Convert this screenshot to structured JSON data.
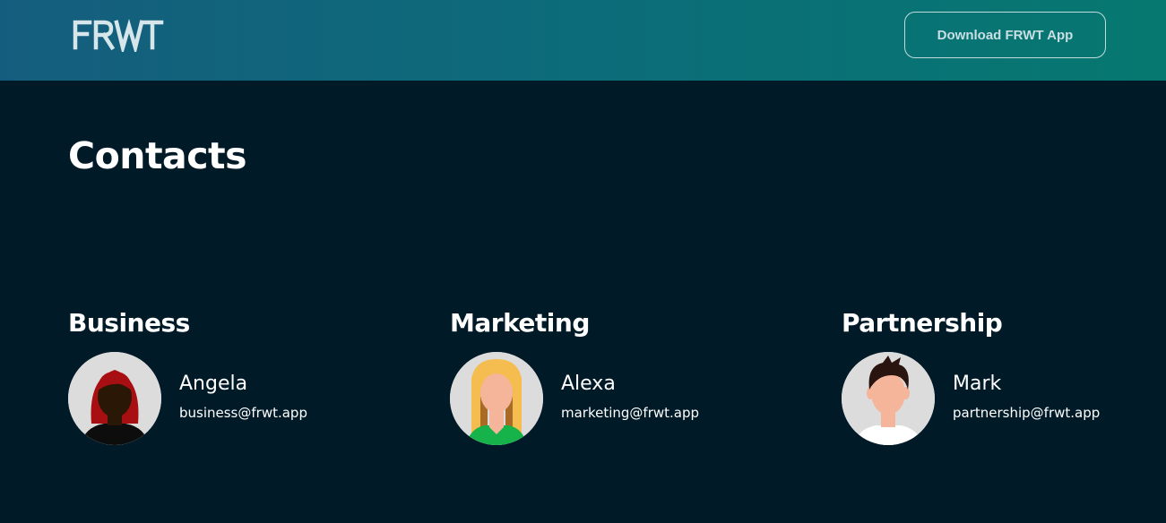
{
  "header": {
    "logo_text": "FRWT",
    "download_label": "Download FRWT App"
  },
  "page": {
    "title": "Contacts"
  },
  "contacts": [
    {
      "department": "Business",
      "name": "Angela",
      "email": "business@frwt.app",
      "avatar_icon": "woman-red-hair-avatar-icon"
    },
    {
      "department": "Marketing",
      "name": "Alexa",
      "email": "marketing@frwt.app",
      "avatar_icon": "woman-blonde-hair-avatar-icon"
    },
    {
      "department": "Partnership",
      "name": "Mark",
      "email": "partnership@frwt.app",
      "avatar_icon": "man-dark-hair-avatar-icon"
    }
  ],
  "colors": {
    "background": "#011a28",
    "header_gradient_start": "#155d7e",
    "header_gradient_end": "#067870",
    "text": "#ffffff"
  }
}
